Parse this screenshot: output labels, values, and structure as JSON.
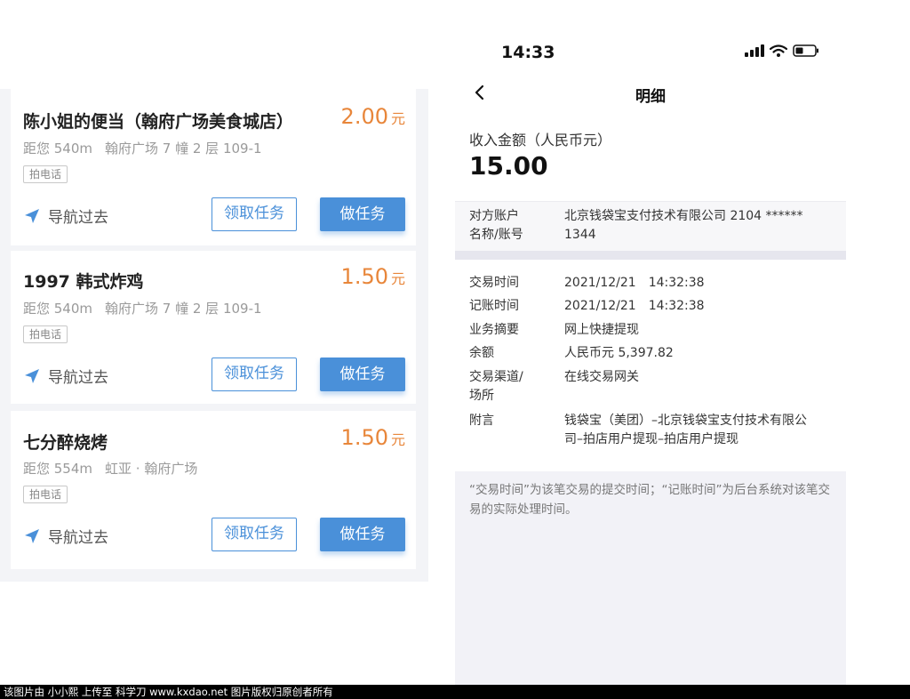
{
  "task_list": {
    "cards": [
      {
        "name": "陈小姐的便当（翰府广场美食城店）",
        "price": "2.00",
        "price_unit": "元",
        "distance": "距您 540m",
        "address": "翰府广场 7 幢 2 层 109-1",
        "phone_tag": "拍电话",
        "nav_label": "导航过去",
        "claim_button": "领取任务",
        "do_button": "做任务"
      },
      {
        "name": "1997 韩式炸鸡",
        "price": "1.50",
        "price_unit": "元",
        "distance": "距您 540m",
        "address": "翰府广场 7 幢 2 层 109-1",
        "phone_tag": "拍电话",
        "nav_label": "导航过去",
        "claim_button": "领取任务",
        "do_button": "做任务"
      },
      {
        "name": "七分醉烧烤",
        "price": "1.50",
        "price_unit": "元",
        "distance": "距您 554m",
        "address": "虹亚 · 翰府广场",
        "phone_tag": "拍电话",
        "nav_label": "导航过去",
        "claim_button": "领取任务",
        "do_button": "做任务"
      }
    ]
  },
  "status_bar": {
    "time": "14:33"
  },
  "detail": {
    "title": "明细",
    "amount_label": "收入金额（人民币元）",
    "amount": "15.00",
    "counterparty_label_1": "对方账户",
    "counterparty_label_2": "名称/账号",
    "counterparty_value_1": "北京钱袋宝支付技术有限公司 2104 ******",
    "counterparty_value_2": "1344",
    "rows": [
      {
        "label": "交易时间",
        "value": "2021/12/21　14:32:38"
      },
      {
        "label": "记账时间",
        "value": "2021/12/21　14:32:38"
      },
      {
        "label": "业务摘要",
        "value": "网上快捷提现"
      },
      {
        "label": "余额",
        "value": "人民币元 5,397.82"
      },
      {
        "label": "交易渠道/",
        "label_2": "场所",
        "value": "在线交易网关"
      },
      {
        "label": "附言",
        "value": "钱袋宝（美团）–北京钱袋宝支付技术有限公司–拍店用户提现–拍店用户提现"
      }
    ],
    "footnote": "“交易时间”为该笔交易的提交时间；“记账时间”为后台系统对该笔交易的实际处理时间。"
  },
  "watermark": "该图片由 小小熙 上传至 科学刀 www.kxdao.net 图片版权归原创者所有",
  "colors": {
    "accent_blue": "#4a90d9",
    "price_orange": "#e8863a"
  }
}
